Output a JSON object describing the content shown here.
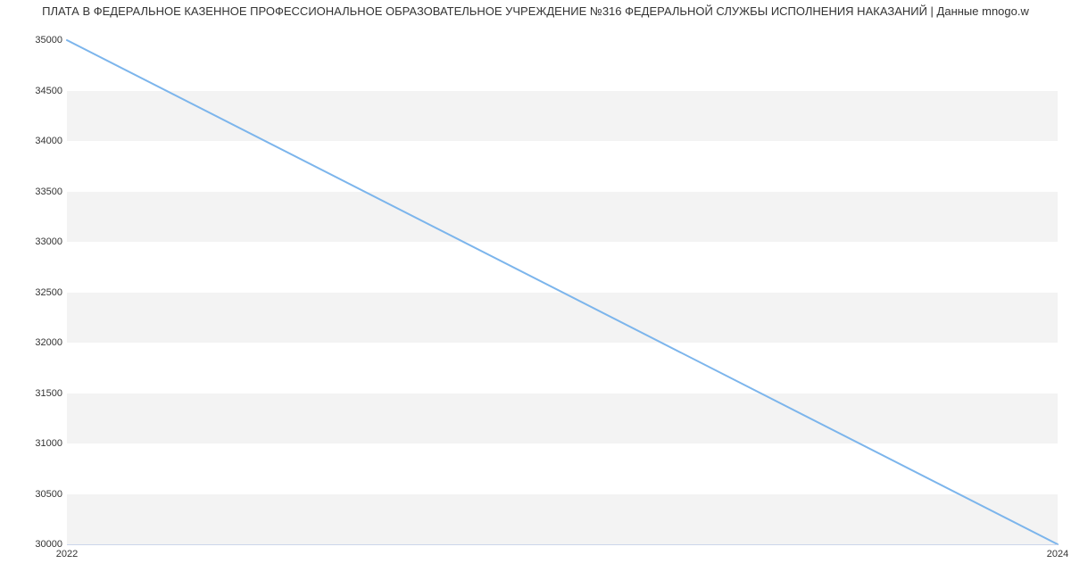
{
  "chart_data": {
    "type": "line",
    "title": "ПЛАТА В ФЕДЕРАЛЬНОЕ КАЗЕННОЕ ПРОФЕССИОНАЛЬНОЕ ОБРАЗОВАТЕЛЬНОЕ УЧРЕЖДЕНИЕ №316 ФЕДЕРАЛЬНОЙ СЛУЖБЫ ИСПОЛНЕНИЯ НАКАЗАНИЙ | Данные mnogo.w",
    "x": [
      2022,
      2024
    ],
    "values": [
      35000,
      30000
    ],
    "xlabel": "",
    "ylabel": "",
    "xlim": [
      2022,
      2024
    ],
    "ylim": [
      30000,
      35000
    ],
    "y_ticks": [
      30000,
      30500,
      31000,
      31500,
      32000,
      32500,
      33000,
      33500,
      34000,
      34500,
      35000
    ],
    "x_ticks": [
      2022,
      2024
    ],
    "line_color": "#7cb5ec"
  }
}
